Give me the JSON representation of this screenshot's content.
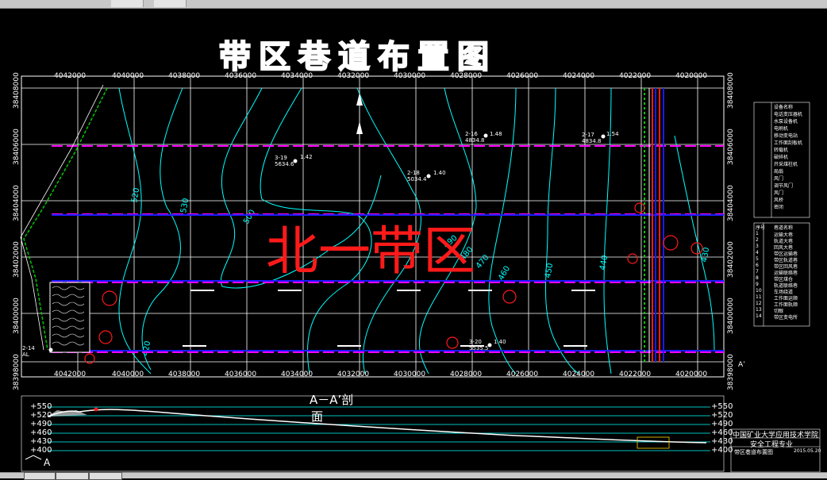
{
  "drawing": {
    "title": "带区巷道布置图",
    "area_label": "北一带区",
    "section_title": "A－A’剖",
    "section_title_2": "面",
    "section_marker_right": "A’",
    "section_marker_left": "A"
  },
  "axis": {
    "x_top": [
      "4042000",
      "4040000",
      "4038000",
      "4036000",
      "4034000",
      "4032000",
      "4030000",
      "4028000",
      "4026000",
      "4024000",
      "4022000",
      "4020000"
    ],
    "x_bottom": [
      "4042000",
      "4040000",
      "4038000",
      "4036000",
      "4034000",
      "4032000",
      "4030000",
      "4028000",
      "4026000",
      "4024000",
      "4022000",
      "4020000"
    ],
    "y_left": [
      "38408000",
      "38406000",
      "38404000",
      "38402000",
      "38400000",
      "38398000"
    ],
    "y_right": [
      "38408000",
      "38406000",
      "38404000",
      "38402000",
      "38400000",
      "38398000"
    ]
  },
  "contours": {
    "labels": [
      "520",
      "530",
      "500",
      "490",
      "480",
      "470",
      "460",
      "450",
      "440",
      "430",
      "420"
    ]
  },
  "boreholes": [
    {
      "id": "3-19",
      "elev": "5634.6",
      "val": "1.42"
    },
    {
      "id": "2-18",
      "elev": "5034.4",
      "val": "1.40"
    },
    {
      "id": "2-16",
      "elev": "4834.8",
      "val": "1.48"
    },
    {
      "id": "2-17",
      "elev": "4834.8",
      "val": "1.54"
    },
    {
      "id": "3-20",
      "elev": "5535.5",
      "val": "1.40"
    },
    {
      "id": "2-14",
      "elev": "AL",
      "val": ""
    }
  ],
  "section_elevations": {
    "left": [
      "+550",
      "+520",
      "+490",
      "+460",
      "+430",
      "+400"
    ],
    "right": [
      "+550",
      "+520",
      "+490",
      "+460",
      "+430",
      "+400"
    ]
  },
  "legend": {
    "rows": [
      "设备名称",
      "电话变压器机",
      "水泵设备机",
      "电刷机",
      "移动变电站",
      "工作面刮板机",
      "转载机",
      "破碎机",
      "开采煤柱机",
      "局扇",
      "风门",
      "调节风门",
      "风门",
      "风桥",
      "密闭"
    ]
  },
  "equipment_table": {
    "header": [
      "序号",
      "巷道名称"
    ],
    "rows": [
      [
        "1",
        "运输大巷"
      ],
      [
        "2",
        "轨道大巷"
      ],
      [
        "3",
        "回风大巷"
      ],
      [
        "4",
        "带区运输巷"
      ],
      [
        "5",
        "带区轨道巷"
      ],
      [
        "6",
        "带区回风巷"
      ],
      [
        "7",
        "运输联络巷"
      ],
      [
        "8",
        "带区煤仓"
      ],
      [
        "9",
        "轨道联络巷"
      ],
      [
        "10",
        "车场绕道"
      ],
      [
        "11",
        "工作面运顺"
      ],
      [
        "12",
        "工作面轨顺"
      ],
      [
        "13",
        "切眼"
      ],
      [
        "14",
        "带区变电所"
      ]
    ]
  },
  "title_block": {
    "school": "中国矿业大学应用技术学院",
    "major": "安全工程专业",
    "drawing_name": "带区巷道布置图",
    "date": "2015.05.20"
  },
  "colors": {
    "grid": "#ffffff",
    "contour": "#00ffff",
    "roadway_magenta": "#ff00ff",
    "roadway_blue": "#1a1aff",
    "area_red": "#ff1a1a",
    "boundary_green": "#00c800"
  }
}
